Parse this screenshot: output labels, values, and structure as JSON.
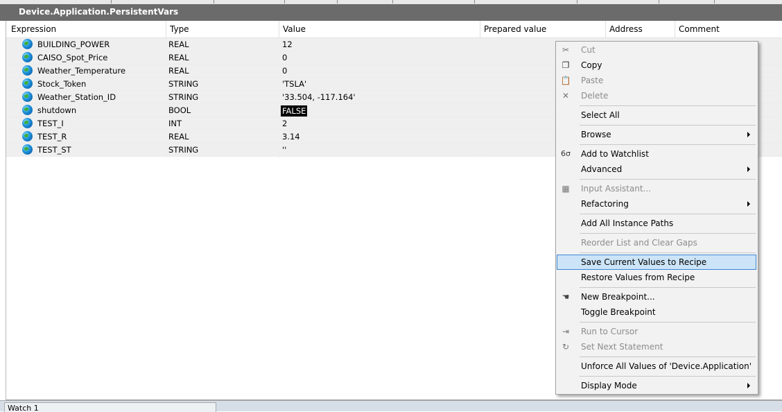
{
  "window": {
    "title": "Device.Application.PersistentVars"
  },
  "columns": {
    "expression": "Expression",
    "type": "Type",
    "value": "Value",
    "prepared": "Prepared value",
    "address": "Address",
    "comment": "Comment"
  },
  "rows": [
    {
      "expression": "BUILDING_POWER",
      "type": "REAL",
      "value": "12"
    },
    {
      "expression": "CAISO_Spot_Price",
      "type": "REAL",
      "value": "0"
    },
    {
      "expression": "Weather_Temperature",
      "type": "REAL",
      "value": "0"
    },
    {
      "expression": "Stock_Token",
      "type": "STRING",
      "value": "'TSLA'"
    },
    {
      "expression": "Weather_Station_ID",
      "type": "STRING",
      "value": "'33.504, -117.164'"
    },
    {
      "expression": "shutdown",
      "type": "BOOL",
      "value": "FALSE"
    },
    {
      "expression": "TEST_I",
      "type": "INT",
      "value": "2"
    },
    {
      "expression": "TEST_R",
      "type": "REAL",
      "value": "3.14"
    },
    {
      "expression": "TEST_ST",
      "type": "STRING",
      "value": "''"
    }
  ],
  "context_menu": {
    "cut": "Cut",
    "copy": "Copy",
    "paste": "Paste",
    "delete": "Delete",
    "select_all": "Select All",
    "browse": "Browse",
    "add_to_watchlist": "Add to Watchlist",
    "advanced": "Advanced",
    "input_assistant": "Input Assistant...",
    "refactoring": "Refactoring",
    "add_all_instance_paths": "Add All Instance Paths",
    "reorder_list": "Reorder List and Clear Gaps",
    "save_current_values": "Save Current Values to Recipe",
    "restore_values": "Restore Values from Recipe",
    "new_breakpoint": "New Breakpoint...",
    "toggle_breakpoint": "Toggle Breakpoint",
    "run_to_cursor": "Run to Cursor",
    "set_next_statement": "Set Next Statement",
    "unforce_all": "Unforce All Values of 'Device.Application'",
    "display_mode": "Display Mode"
  },
  "bottom_tab": {
    "label": "Watch 1"
  },
  "icons": {
    "variable": "globe-icon",
    "cut": "scissors-icon",
    "copy": "copy-icon",
    "paste": "paste-icon",
    "delete": "x-icon",
    "watchlist": "glasses-icon",
    "input_assistant": "assistant-icon",
    "breakpoint": "hand-icon",
    "run_to_cursor": "arrow-lines-icon",
    "set_next_statement": "curved-arrow-icon"
  },
  "colors": {
    "title_bar": "#6b6b6b",
    "highlight": "#cce4f7",
    "highlight_border": "#3c85d6",
    "row_bg": "#efefef"
  }
}
